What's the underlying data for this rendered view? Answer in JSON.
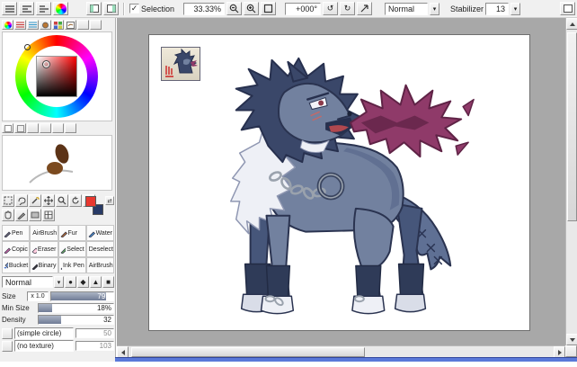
{
  "toolbar": {
    "selection_label": "Selection",
    "zoom_value": "33.33%",
    "angle_value": "+000°",
    "mode_value": "Normal",
    "stabilizer_label": "Stabilizer",
    "stabilizer_value": "13"
  },
  "panel": {
    "brushes": [
      "Pen",
      "AirBrush",
      "Fur",
      "Water",
      "Copic",
      "Eraser",
      "Select",
      "Deselect",
      "Bucket",
      "Binary",
      "Ink Pen",
      "AirBrush"
    ],
    "blend_mode": "Normal",
    "size_label": "Size",
    "size_multiplier": "x 1.0",
    "size_value": "79.0",
    "size_percent": 88,
    "min_size_label": "Min Size",
    "min_size_value": "18%",
    "min_size_percent": 18,
    "density_label": "Density",
    "density_value": "32",
    "density_percent": 30,
    "edge_label": "(simple circle)",
    "edge_value": "50",
    "texture_label": "(no texture)",
    "texture_value": "103"
  },
  "colors": {
    "workspace_bg": "#a8a8a8",
    "canvas_bg": "#ffffff",
    "wolf_body": "#72819f",
    "wolf_mane": "#3a4769",
    "flame": "#8f3a69",
    "fg_swatch": "#e8382f",
    "bg_swatch": "#273a66"
  }
}
